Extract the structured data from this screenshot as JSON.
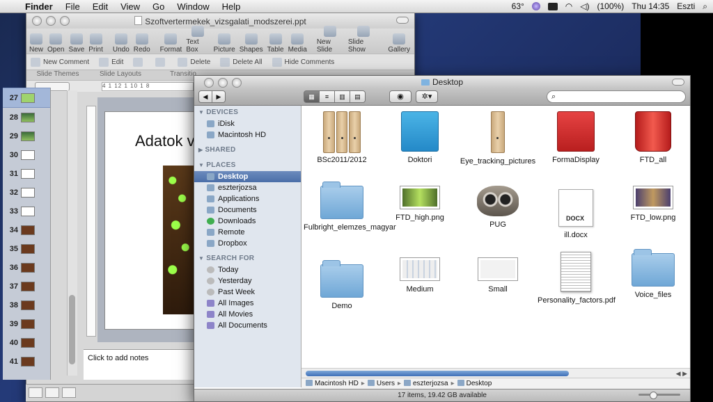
{
  "menubar": {
    "app": "Finder",
    "items": [
      "File",
      "Edit",
      "View",
      "Go",
      "Window",
      "Help"
    ],
    "status": {
      "temperature": "63°",
      "battery": "(100%)",
      "clock": "Thu 14:35",
      "user": "Eszti"
    }
  },
  "ppt": {
    "window_title": "Szoftvertermekek_vizsgalati_modszerei.ppt",
    "toolbar": [
      "New",
      "Open",
      "Save",
      "Print",
      "Undo",
      "Redo",
      "Format",
      "Text Box",
      "Picture",
      "Shapes",
      "Table",
      "Media",
      "New Slide",
      "Slide Show",
      "Gallery"
    ],
    "ribbon": [
      "New Comment",
      "Edit",
      "Delete",
      "Delete All",
      "Hide Comments"
    ],
    "tabs": [
      "Slide Themes",
      "Slide Layouts",
      "Transitio"
    ],
    "ruler_text": "4 1 12 1 10 1 8",
    "slide_numbers": [
      "27",
      "28",
      "29",
      "30",
      "31",
      "32",
      "33",
      "34",
      "35",
      "36",
      "37",
      "38",
      "39",
      "40",
      "41"
    ],
    "slide_title": "Adatok v",
    "notes_placeholder": "Click to add notes"
  },
  "finder": {
    "title": "Desktop",
    "sidebar": [
      {
        "heading": "DEVICES",
        "items": [
          "iDisk",
          "Macintosh HD"
        ]
      },
      {
        "heading": "SHARED",
        "items": []
      },
      {
        "heading": "PLACES",
        "items": [
          "Desktop",
          "eszterjozsa",
          "Applications",
          "Documents",
          "Downloads",
          "Remote",
          "Dropbox"
        ]
      },
      {
        "heading": "SEARCH FOR",
        "items": [
          "Today",
          "Yesterday",
          "Past Week",
          "All Images",
          "All Movies",
          "All Documents"
        ]
      }
    ],
    "selected_sidebar": "Desktop",
    "files": [
      {
        "name": "BSc2011/2012",
        "icon": "cabinet-icon"
      },
      {
        "name": "Doktori",
        "icon": "blue-cabinet-icon"
      },
      {
        "name": "Eye_tracking_pictures",
        "icon": "cabinet-icon"
      },
      {
        "name": "FormaDisplay",
        "icon": "red-cabinet-icon"
      },
      {
        "name": "FTD_all",
        "icon": "trash-icon"
      },
      {
        "name": "Fulbright_elemzes_magyar",
        "icon": "folder-icon"
      },
      {
        "name": "FTD_high.png",
        "icon": "image-icon"
      },
      {
        "name": "PUG",
        "icon": "pug-icon"
      },
      {
        "name": "ill.docx",
        "icon": "docx-icon"
      },
      {
        "name": "FTD_low.png",
        "icon": "image-icon"
      },
      {
        "name": "Demo",
        "icon": "folder-icon"
      },
      {
        "name": "Medium",
        "icon": "screenshot-icon"
      },
      {
        "name": "Small",
        "icon": "screenshot-icon"
      },
      {
        "name": "Personality_factors.pdf",
        "icon": "pdf-icon"
      },
      {
        "name": "Voice_files",
        "icon": "folder-icon"
      }
    ],
    "docx_badge": "DOCX",
    "path": [
      "Macintosh HD",
      "Users",
      "eszterjozsa",
      "Desktop"
    ],
    "status": "17 items, 19.42 GB available"
  }
}
